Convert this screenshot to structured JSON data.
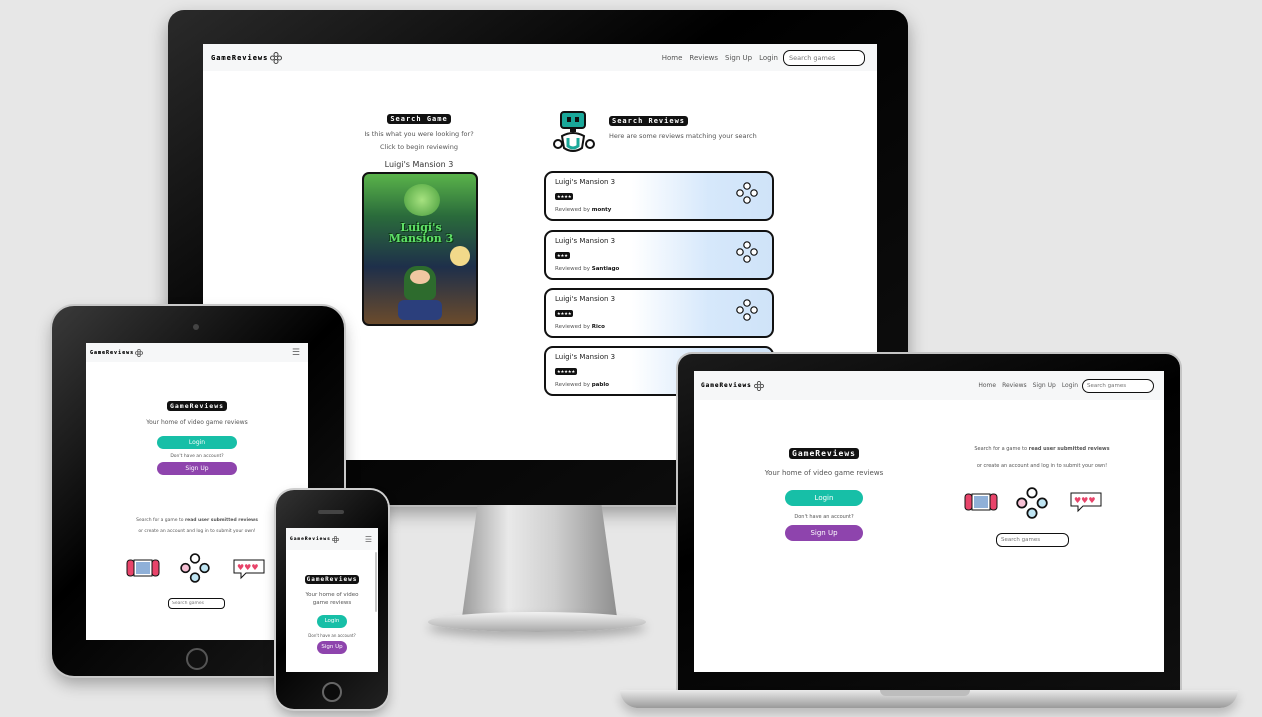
{
  "brand": {
    "name": "GameReviews"
  },
  "nav": {
    "home": "Home",
    "reviews": "Reviews",
    "signup": "Sign Up",
    "login": "Login",
    "search_placeholder": "Search games"
  },
  "search_page": {
    "game_heading": "Search Game",
    "game_question": "Is this what you were looking for?",
    "game_cta": "Click to begin reviewing",
    "game_title": "Luigi's Mansion 3",
    "cover_text": "Luigi's Mansion 3",
    "reviews_heading": "Search Reviews",
    "reviews_subtitle": "Here are some reviews matching your search",
    "reviews": [
      {
        "game": "Luigi's Mansion 3",
        "rating": "★★★★",
        "reviewed_by": "Reviewed by",
        "user": "monty"
      },
      {
        "game": "Luigi's Mansion 3",
        "rating": "★★★",
        "reviewed_by": "Reviewed by",
        "user": "Santiago"
      },
      {
        "game": "Luigi's Mansion 3",
        "rating": "★★★★",
        "reviewed_by": "Reviewed by",
        "user": "Rico"
      },
      {
        "game": "Luigi's Mansion 3",
        "rating": "★★★★★",
        "reviewed_by": "Reviewed by",
        "user": "pablo"
      }
    ]
  },
  "home_page": {
    "heading": "GameReviews",
    "tagline": "Your home of video game reviews",
    "login_button": "Login",
    "no_account": "Don't have an account?",
    "signup_button": "Sign Up",
    "search_info_1_start": "Search for a game to ",
    "search_info_1_bold": "read user submitted reviews",
    "search_info_2": "or create an account and log in to submit your own!",
    "search_placeholder": "Search games"
  },
  "phone_page": {
    "tagline": "Your home of video game reviews"
  },
  "colors": {
    "login": "#17bfa7",
    "signup": "#8e44ad",
    "card_gradient": "#d6e8fb",
    "robot": "#1aa89a"
  }
}
